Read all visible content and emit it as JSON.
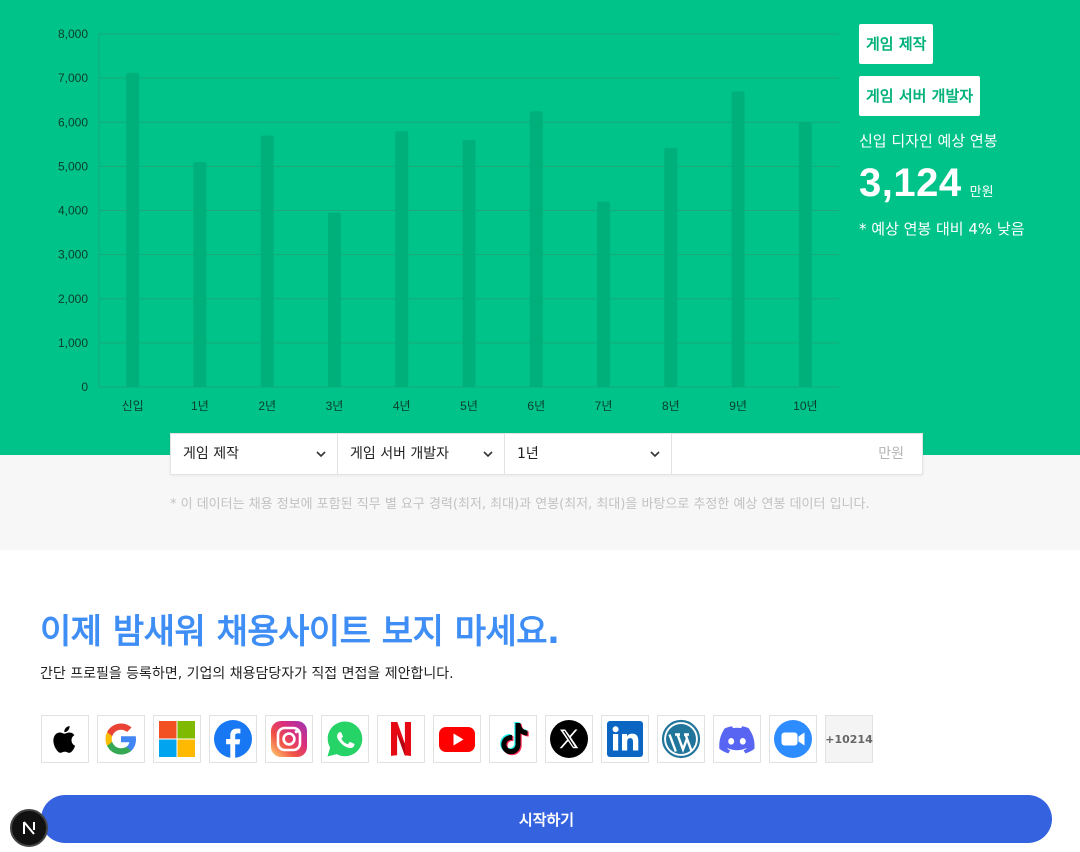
{
  "chart_data": {
    "type": "bar",
    "categories": [
      "신입",
      "1년",
      "2년",
      "3년",
      "4년",
      "5년",
      "6년",
      "7년",
      "8년",
      "9년",
      "10년"
    ],
    "values": [
      7120,
      5100,
      5700,
      3950,
      5800,
      5600,
      6250,
      4200,
      5420,
      6700,
      6000
    ],
    "ylim": [
      0,
      8000
    ],
    "yticks": [
      0,
      1000,
      2000,
      3000,
      4000,
      5000,
      6000,
      7000,
      8000
    ],
    "ytick_labels": [
      "0",
      "1,000",
      "2,000",
      "3,000",
      "4,000",
      "5,000",
      "6,000",
      "7,000",
      "8,000"
    ],
    "grid": true,
    "colors": {
      "bar": "#00b07a",
      "grid": "#19a877",
      "background": "#00c389"
    }
  },
  "side": {
    "chips": [
      "게임 제작",
      "게임 서버 개발자"
    ],
    "label": "신입 디자인 예상 연봉",
    "salary_value": "3,124",
    "salary_unit": "만원",
    "note": "* 예상 연봉 대비 4% 낮음"
  },
  "filters": {
    "category": "게임 제작",
    "job": "게임 서버 개발자",
    "years": "1년",
    "amount_placeholder": "만원"
  },
  "disclaimer": "* 이 데이터는 채용 정보에 포함된 직무 별 요구 경력(최저, 최대)과 연봉(최저, 최대)을 바탕으로 추정한 예상 연봉 데이터 입니다.",
  "cta": {
    "title": "이제 밤새워 채용사이트 보지 마세요.",
    "subtitle": "간단 프로필을 등록하면, 기업의 채용담당자가 직접 면접을 제안합니다.",
    "more_count": "+10214",
    "start_label": "시작하기"
  },
  "logos": [
    "apple-icon",
    "google-icon",
    "microsoft-icon",
    "facebook-icon",
    "instagram-icon",
    "whatsapp-icon",
    "netflix-icon",
    "youtube-icon",
    "tiktok-icon",
    "x-icon",
    "linkedin-icon",
    "wordpress-icon",
    "discord-icon",
    "zoom-icon"
  ],
  "colors": {
    "accent_green": "#00c389",
    "title_blue": "#3e8ef5",
    "button_blue": "#3563e0"
  }
}
